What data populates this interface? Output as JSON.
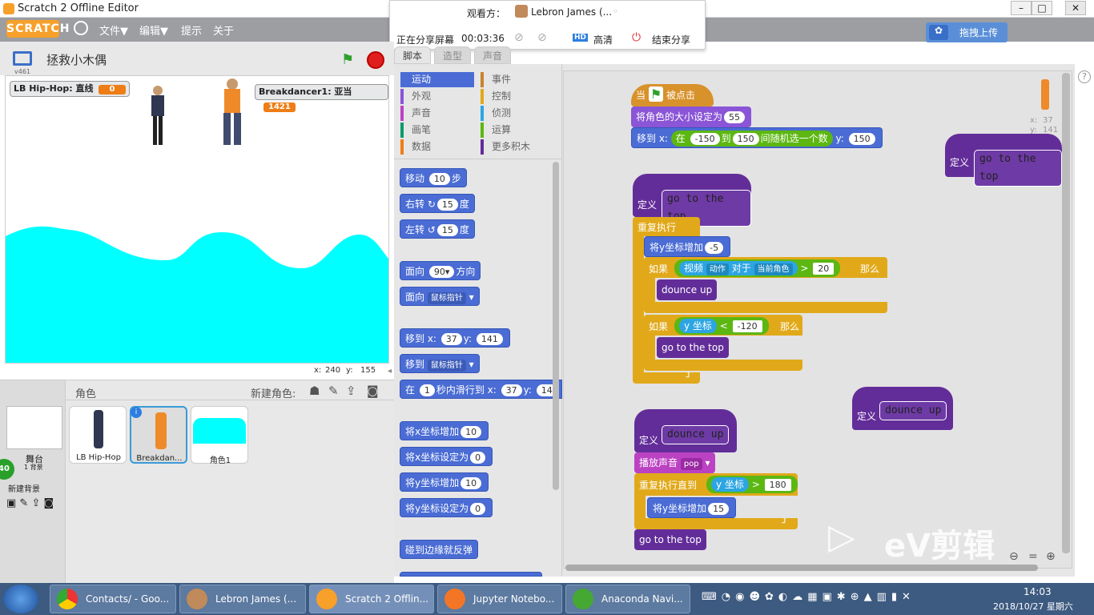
{
  "window": {
    "title": "Scratch 2 Offline Editor"
  },
  "menu": {
    "logo": "SCRATCH",
    "items": [
      "文件▼",
      "编辑▼",
      "提示",
      "关于"
    ]
  },
  "share": {
    "viewer_label": "观看方：",
    "viewer_name": "Lebron James (...",
    "sharing_label": "正在分享屏幕",
    "elapsed": "00:03:36",
    "hd_badge": "HD",
    "hd_label": "高清",
    "end_label": "结束分享"
  },
  "upload_button": "拖拽上传",
  "stage": {
    "project_name": "拯救小木偶",
    "version": "v461",
    "monitors": [
      {
        "label": "LB Hip-Hop: 直线",
        "value": "0"
      },
      {
        "label": "Breakdancer1: 亚当",
        "value": "1421"
      }
    ],
    "mouse_x_label": "x:",
    "mouse_x": "240",
    "mouse_y_label": "y:",
    "mouse_y": "155",
    "wave_color": "#00ffff"
  },
  "sprites": {
    "header": "角色",
    "new_label": "新建角色:",
    "stage_label": "舞台",
    "stage_sub": "1 背景",
    "new_backdrop": "新建背景",
    "badge": "40",
    "list": [
      "LB Hip-Hop",
      "Breakdan...",
      "角色1"
    ]
  },
  "tabs": [
    "脚本",
    "造型",
    "声音"
  ],
  "categories": {
    "left": [
      {
        "label": "运动",
        "color": "#4a6cd4",
        "active": true
      },
      {
        "label": "外观",
        "color": "#8a55d7"
      },
      {
        "label": "声音",
        "color": "#bb42c3"
      },
      {
        "label": "画笔",
        "color": "#0e9a6c"
      },
      {
        "label": "数据",
        "color": "#ee7d16"
      }
    ],
    "right": [
      {
        "label": "事件",
        "color": "#c88330"
      },
      {
        "label": "控制",
        "color": "#e1a91a"
      },
      {
        "label": "侦测",
        "color": "#2ca5e2"
      },
      {
        "label": "运算",
        "color": "#5cb712"
      },
      {
        "label": "更多积木",
        "color": "#632d99"
      }
    ]
  },
  "palette": {
    "move": {
      "a": "移动",
      "v": "10",
      "b": "步"
    },
    "turn_right": {
      "a": "右转",
      "icon": "↻",
      "v": "15",
      "b": "度"
    },
    "turn_left": {
      "a": "左转",
      "icon": "↺",
      "v": "15",
      "b": "度"
    },
    "point_dir": {
      "a": "面向",
      "v": "90▾",
      "b": "方向"
    },
    "point_towards": {
      "a": "面向",
      "dd": "鼠标指针"
    },
    "goto_xy": {
      "a": "移到 x:",
      "x": "37",
      "b": "y:",
      "y": "141"
    },
    "goto": {
      "a": "移到",
      "dd": "鼠标指针"
    },
    "glide": {
      "a": "在",
      "v": "1",
      "b": "秒内滑行到 x:",
      "x": "37",
      "c": "y:",
      "y": "14"
    },
    "change_x": {
      "a": "将x坐标增加",
      "v": "10"
    },
    "set_x": {
      "a": "将x坐标设定为",
      "v": "0"
    },
    "change_y": {
      "a": "将y坐标增加",
      "v": "10"
    },
    "set_y": {
      "a": "将y坐标设定为",
      "v": "0"
    },
    "bounce": "碰到边缘就反弹"
  },
  "scripts": {
    "when_flag_a": "当",
    "when_flag_b": "被点击",
    "set_size_a": "将角色的大小设定为",
    "set_size_v": "55",
    "goto_a": "移到 x:",
    "goto_rand_a": "在",
    "goto_rand_from": "-150",
    "goto_rand_to_lbl": "到",
    "goto_rand_to": "150",
    "goto_rand_b": "间随机选一个数",
    "goto_y_lbl": "y:",
    "goto_y": "150",
    "define": "定义",
    "proc_top": "go to the top",
    "proc_dounce": "dounce up",
    "forever": "重复执行",
    "change_y_a": "将y坐标增加",
    "change_y_v": "-5",
    "if": "如果",
    "then": "那么",
    "video": "视频",
    "video_dd": "动作",
    "video_on": "对于",
    "video_target": "当前角色",
    "gt": ">",
    "video_v": "20",
    "ypos": "y 坐标",
    "lt": "<",
    "ypos_v": "-120",
    "play_sound": "播放声音",
    "sound_dd": "pop",
    "repeat_until": "重复执行直到",
    "ypos_v2": "180",
    "change_y_v2": "15",
    "corner_x_label": "x:",
    "corner_x": "37",
    "corner_y_label": "y:",
    "corner_y": "141"
  },
  "watermark": "eV剪辑",
  "taskbar": {
    "items": [
      "Contacts/ - Goo...",
      "Lebron James (...",
      "Scratch 2 Offlin...",
      "Jupyter Notebo...",
      "Anaconda Navi..."
    ],
    "time": "14:03",
    "date": "2018/10/27 星期六"
  }
}
